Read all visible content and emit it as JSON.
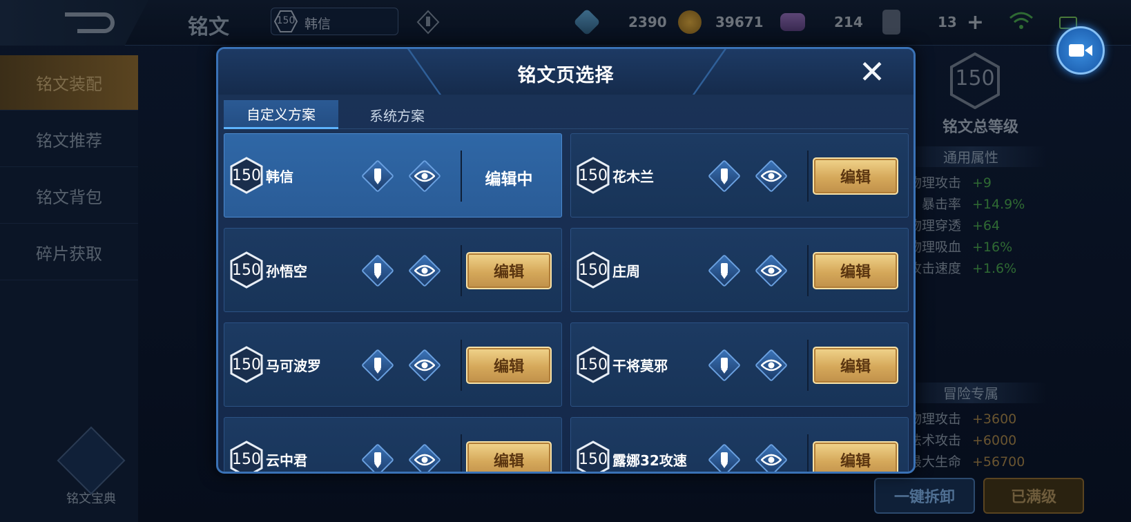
{
  "topbar": {
    "page_title": "铭文",
    "hero_level": "150",
    "hero_name": "韩信",
    "resources": [
      {
        "icon": "diamond-gem-icon",
        "value": "2390"
      },
      {
        "icon": "gold-coin-icon",
        "value": "39671"
      },
      {
        "icon": "purple-crystal-icon",
        "value": "214"
      },
      {
        "icon": "card-icon",
        "value": "13"
      }
    ]
  },
  "sidebar": {
    "items": [
      {
        "label": "铭文装配"
      },
      {
        "label": "铭文推荐"
      },
      {
        "label": "铭文背包"
      },
      {
        "label": "碎片获取"
      }
    ],
    "codex_label": "铭文宝典"
  },
  "rightpanel": {
    "total_level": "150",
    "total_label": "铭文总等级",
    "general_title": "通用属性",
    "general_attrs": [
      {
        "k": "物理攻击",
        "v": "+9"
      },
      {
        "k": "暴击率",
        "v": "+14.9%"
      },
      {
        "k": "物理穿透",
        "v": "+64"
      },
      {
        "k": "物理吸血",
        "v": "+16%"
      },
      {
        "k": "攻击速度",
        "v": "+1.6%"
      }
    ],
    "adv_title": "冒险专属",
    "adv_attrs": [
      {
        "k": "物理攻击",
        "v": "+3600"
      },
      {
        "k": "法术攻击",
        "v": "+6000"
      },
      {
        "k": "最大生命",
        "v": "+56700"
      }
    ],
    "unload_label": "一键拆卸",
    "max_label": "已满级"
  },
  "modal": {
    "title": "铭文页选择",
    "tabs": [
      {
        "label": "自定义方案"
      },
      {
        "label": "系统方案"
      }
    ],
    "edit_label": "编辑",
    "editing_label": "编辑中",
    "pages": [
      {
        "level": "150",
        "name": "韩信"
      },
      {
        "level": "150",
        "name": "花木兰"
      },
      {
        "level": "150",
        "name": "孙悟空"
      },
      {
        "level": "150",
        "name": "庄周"
      },
      {
        "level": "150",
        "name": "马可波罗"
      },
      {
        "level": "150",
        "name": "干将莫邪"
      },
      {
        "level": "150",
        "name": "云中君"
      },
      {
        "level": "150",
        "name": "露娜32攻速"
      }
    ]
  }
}
